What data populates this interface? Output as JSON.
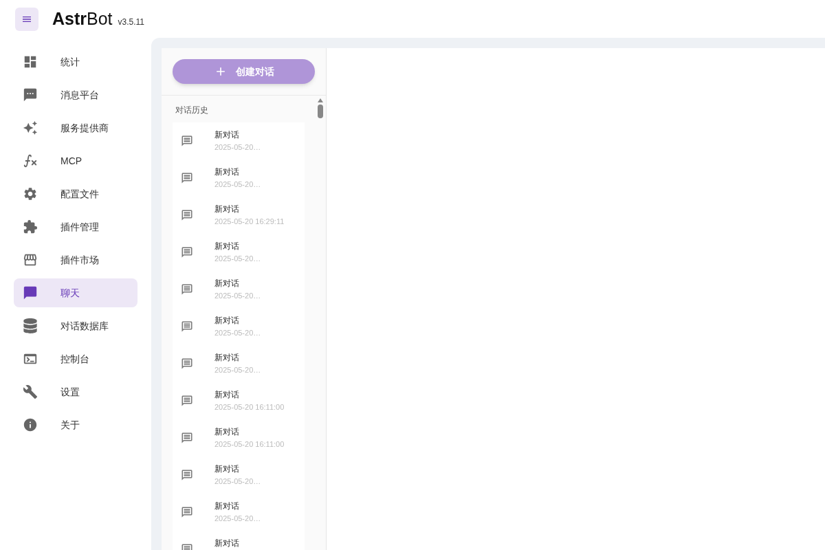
{
  "header": {
    "logo": "**Astr**Bot",
    "version": "v3.5.11"
  },
  "sidebar": {
    "items": [
      {
        "label": "统计",
        "selected": false
      },
      {
        "label": "消息平台",
        "selected": false
      },
      {
        "label": "服务提供商",
        "selected": false
      },
      {
        "label": "MCP",
        "selected": false
      },
      {
        "label": "配置文件",
        "selected": false
      },
      {
        "label": "插件管理",
        "selected": false
      },
      {
        "label": "插件市场",
        "selected": false
      },
      {
        "label": "聊天",
        "selected": true
      },
      {
        "label": "对话数据库",
        "selected": false
      },
      {
        "label": "控制台",
        "selected": false
      },
      {
        "label": "设置",
        "selected": false
      },
      {
        "label": "关于",
        "selected": false
      }
    ]
  },
  "chat": {
    "new_button": "创建对话",
    "history_title": "对话历史",
    "conversations": [
      {
        "title": "新对话",
        "time": "2025-05-20…"
      },
      {
        "title": "新对话",
        "time": "2025-05-20…"
      },
      {
        "title": "新对话",
        "time": "2025-05-20 16:29:11"
      },
      {
        "title": "新对话",
        "time": "2025-05-20…"
      },
      {
        "title": "新对话",
        "time": "2025-05-20…"
      },
      {
        "title": "新对话",
        "time": "2025-05-20…"
      },
      {
        "title": "新对话",
        "time": "2025-05-20…"
      },
      {
        "title": "新对话",
        "time": "2025-05-20 16:11:00"
      },
      {
        "title": "新对话",
        "time": "2025-05-20 16:11:00"
      },
      {
        "title": "新对话",
        "time": "2025-05-20…"
      },
      {
        "title": "新对话",
        "time": "2025-05-20…"
      },
      {
        "title": "新对话"
      }
    ]
  }
}
